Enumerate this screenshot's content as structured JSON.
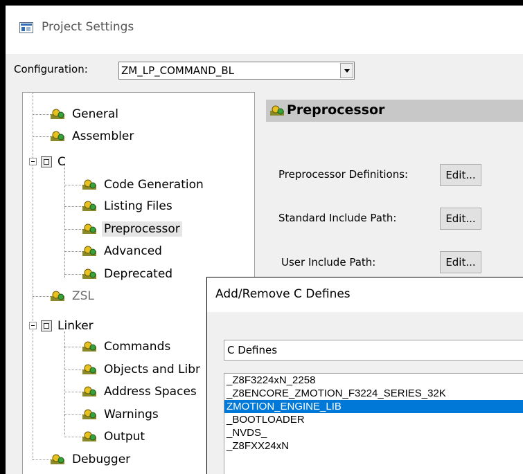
{
  "window": {
    "title": "Project Settings",
    "icon": "project-settings-icon"
  },
  "configuration": {
    "label": "Configuration:",
    "value": "ZM_LP_COMMAND_BL"
  },
  "tree": {
    "items": [
      {
        "label": "General",
        "icon": "gear-icon"
      },
      {
        "label": "Assembler",
        "icon": "gear-icon"
      },
      {
        "label": "C",
        "icon": "folder-icon",
        "expanded": true
      },
      {
        "label": "Code Generation",
        "icon": "gear-icon"
      },
      {
        "label": "Listing Files",
        "icon": "gear-icon"
      },
      {
        "label": "Preprocessor",
        "icon": "gear-icon",
        "selected": true
      },
      {
        "label": "Advanced",
        "icon": "gear-icon"
      },
      {
        "label": "Deprecated",
        "icon": "gear-icon"
      },
      {
        "label": "ZSL",
        "icon": "gear-icon",
        "disabled": true
      },
      {
        "label": "Linker",
        "icon": "folder-icon",
        "expanded": true
      },
      {
        "label": "Commands",
        "icon": "gear-icon"
      },
      {
        "label": "Objects and Libr",
        "icon": "gear-icon"
      },
      {
        "label": "Address Spaces",
        "icon": "gear-icon"
      },
      {
        "label": "Warnings",
        "icon": "gear-icon"
      },
      {
        "label": "Output",
        "icon": "gear-icon"
      },
      {
        "label": "Debugger",
        "icon": "gear-icon"
      }
    ]
  },
  "panel": {
    "title": "Preprocessor",
    "fields": [
      {
        "label": "Preprocessor Definitions:",
        "button": "Edit..."
      },
      {
        "label": "Standard Include Path:",
        "button": "Edit..."
      },
      {
        "label": "User Include Path:",
        "button": "Edit..."
      }
    ]
  },
  "dialog": {
    "title": "Add/Remove C Defines",
    "group_label": "C Defines",
    "defines": [
      "_Z8F3224xN_2258",
      "_Z8ENCORE_ZMOTION_F3224_SERIES_32K",
      "ZMOTION_ENGINE_LIB",
      "_BOOTLOADER",
      "_NVDS_",
      "_Z8FXX24xN"
    ],
    "selected_index": 2
  },
  "colors": {
    "selection": "#0078d7",
    "header_bg": "#c8c8c8",
    "window_bg": "#f0f0f0"
  }
}
